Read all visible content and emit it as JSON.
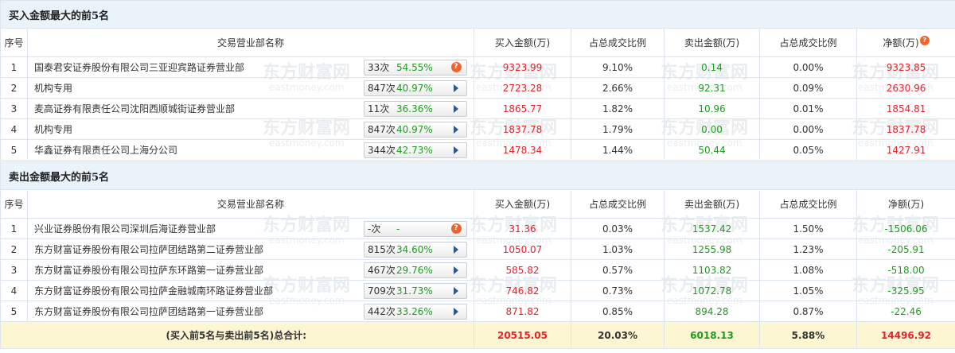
{
  "buy_section": {
    "title": "买入金额最大的前5名",
    "headers": [
      "序号",
      "交易营业部名称",
      "买入金额(万)",
      "占总成交比例",
      "卖出金额(万)",
      "占总成交比例",
      "净额(万)"
    ],
    "rows": [
      {
        "idx": "1",
        "name": "国泰君安证券股份有限公司三亚迎宾路证券营业部",
        "count": "33次",
        "pct": "54.55%",
        "pct_color": "red",
        "icon": "question",
        "buy": "9323.99",
        "buy_ratio": "9.10%",
        "sell": "0.14",
        "sell_ratio": "0.00%",
        "net": "9323.85"
      },
      {
        "idx": "2",
        "name": "机构专用",
        "count": "847次",
        "pct": "40.97%",
        "pct_color": "green",
        "icon": "arrow",
        "buy": "2723.28",
        "buy_ratio": "2.66%",
        "sell": "92.31",
        "sell_ratio": "0.09%",
        "net": "2630.96"
      },
      {
        "idx": "3",
        "name": "麦高证券有限责任公司沈阳西顺城街证券营业部",
        "count": "11次",
        "pct": "36.36%",
        "pct_color": "green",
        "icon": "arrow",
        "buy": "1865.77",
        "buy_ratio": "1.82%",
        "sell": "10.96",
        "sell_ratio": "0.01%",
        "net": "1854.81"
      },
      {
        "idx": "4",
        "name": "机构专用",
        "count": "847次",
        "pct": "40.97%",
        "pct_color": "green",
        "icon": "arrow",
        "buy": "1837.78",
        "buy_ratio": "1.79%",
        "sell": "0.00",
        "sell_ratio": "0.00%",
        "net": "1837.78"
      },
      {
        "idx": "5",
        "name": "华鑫证券有限责任公司上海分公司",
        "count": "344次",
        "pct": "42.73%",
        "pct_color": "green",
        "icon": "arrow",
        "buy": "1478.34",
        "buy_ratio": "1.44%",
        "sell": "50.44",
        "sell_ratio": "0.05%",
        "net": "1427.91"
      }
    ]
  },
  "sell_section": {
    "title": "卖出金额最大的前5名",
    "headers": [
      "序号",
      "交易营业部名称",
      "买入金额(万)",
      "占总成交比例",
      "卖出金额(万)",
      "占总成交比例",
      "净额(万)"
    ],
    "rows": [
      {
        "idx": "1",
        "name": "兴业证券股份有限公司深圳后海证券营业部",
        "count": "-次",
        "pct": "-",
        "pct_color": "dark",
        "icon": "question",
        "buy": "31.36",
        "buy_ratio": "0.03%",
        "sell": "1537.42",
        "sell_ratio": "1.50%",
        "net": "-1506.06"
      },
      {
        "idx": "2",
        "name": "东方财富证券股份有限公司拉萨团结路第二证券营业部",
        "count": "815次",
        "pct": "34.60%",
        "pct_color": "green",
        "icon": "arrow",
        "buy": "1050.07",
        "buy_ratio": "1.03%",
        "sell": "1255.98",
        "sell_ratio": "1.23%",
        "net": "-205.91"
      },
      {
        "idx": "3",
        "name": "东方财富证券股份有限公司拉萨东环路第一证券营业部",
        "count": "467次",
        "pct": "29.76%",
        "pct_color": "green",
        "icon": "arrow",
        "buy": "585.82",
        "buy_ratio": "0.57%",
        "sell": "1103.82",
        "sell_ratio": "1.08%",
        "net": "-518.00"
      },
      {
        "idx": "4",
        "name": "东方财富证券股份有限公司拉萨金融城南环路证券营业部",
        "count": "709次",
        "pct": "31.73%",
        "pct_color": "green",
        "icon": "arrow",
        "buy": "746.82",
        "buy_ratio": "0.73%",
        "sell": "1072.78",
        "sell_ratio": "1.05%",
        "net": "-325.95"
      },
      {
        "idx": "5",
        "name": "东方财富证券股份有限公司拉萨团结路第一证券营业部",
        "count": "442次",
        "pct": "33.26%",
        "pct_color": "green",
        "icon": "arrow",
        "buy": "871.82",
        "buy_ratio": "0.85%",
        "sell": "894.28",
        "sell_ratio": "0.87%",
        "net": "-22.46"
      }
    ]
  },
  "total": {
    "label_prefix": "(买入前5名与卖出前5名)",
    "label_bold": "总合计:",
    "buy": "20515.05",
    "buy_ratio": "20.03%",
    "sell": "6018.13",
    "sell_ratio": "5.88%",
    "net": "14496.92"
  },
  "watermark": {
    "cn": "东方财富网",
    "en": "eastmoney.com"
  },
  "icons": {
    "help": "question-icon",
    "expand": "triangle-right-icon"
  },
  "colors": {
    "positive": "#e3232a",
    "negative": "#1e9c1e",
    "section_bg": "#eaf2fa",
    "total_bg": "#fdf6d2",
    "help_icon": "#f0642c"
  }
}
